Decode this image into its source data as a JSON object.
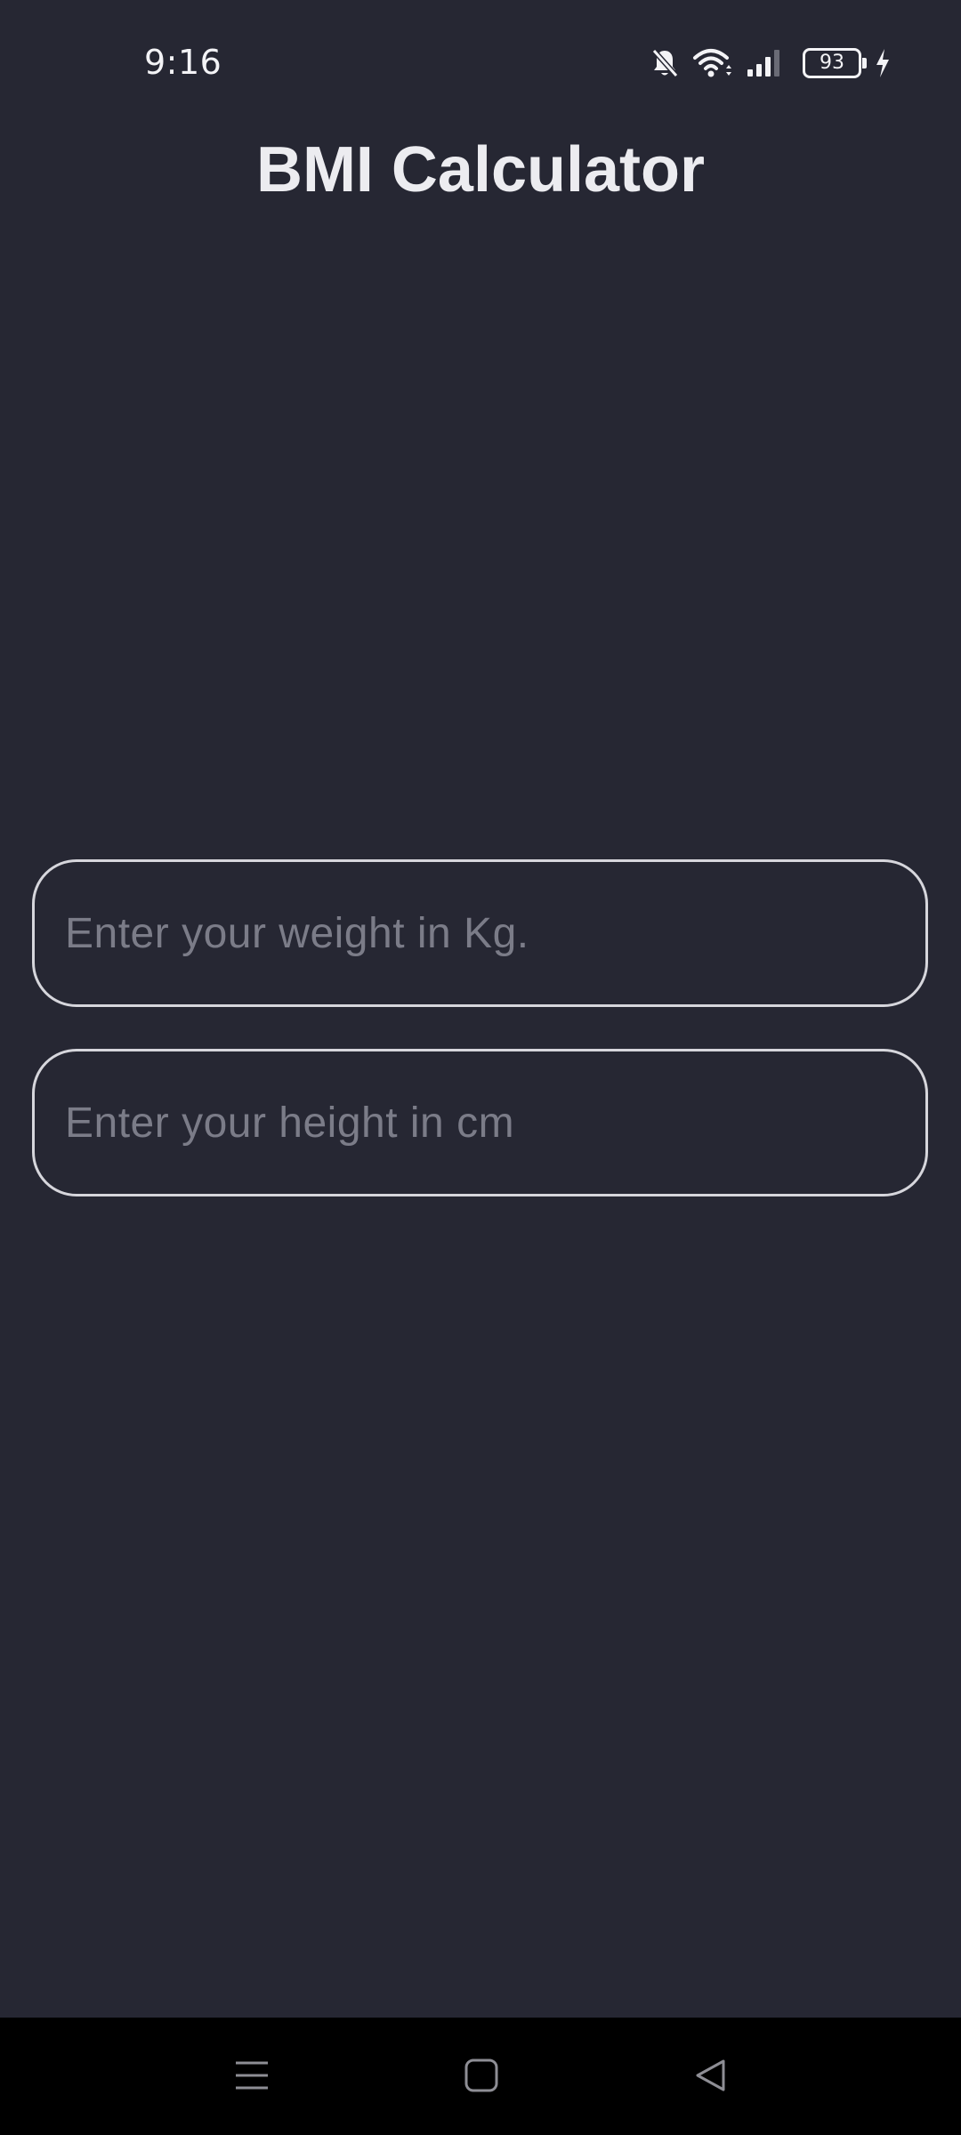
{
  "status_bar": {
    "time": "9:16",
    "battery_level": "93",
    "icons": [
      "bell-off-icon",
      "wifi-icon",
      "signal-icon",
      "battery-icon",
      "charging-icon"
    ]
  },
  "app": {
    "title": "BMI Calculator"
  },
  "form": {
    "weight_placeholder": "Enter your weight in Kg.",
    "weight_value": "",
    "height_placeholder": "Enter your height in cm",
    "height_value": ""
  },
  "nav_bar": {
    "buttons": [
      "menu-icon",
      "home-icon",
      "back-icon"
    ]
  },
  "colors": {
    "background": "#262733",
    "text": "#ECECF0",
    "placeholder": "#7B7C88",
    "field_border": "#D6D6DC",
    "nav_background": "#000000"
  }
}
